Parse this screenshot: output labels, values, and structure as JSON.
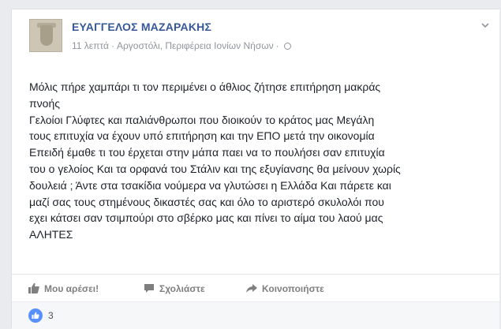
{
  "post": {
    "author": "ΕΥΑΓΓΕΛΟΣ ΜΑΖΑΡΑΚΗΣ",
    "time": "11 λεπτά",
    "separator": "·",
    "location": "Αργοστόλι, Περιφέρεια Ιονίων Νήσων",
    "privacy_icon": "globe-icon",
    "menu_icon": "chevron-down-icon",
    "text": "Μόλις πήρε χαμπάρι τι τον περιμένει ο άθλιος ζήτησε επιτήρηση μακράς\nπνοής\nΓελοίοι Γλύφτες και παλιάνθρωποι που διοικούν το κράτος μας Μεγάλη\nτους επιτυχία να έχουν υπό επιτήρηση και την ΕΠΟ μετά την οικονομία\nΕπειδή έμαθε τι του έρχεται στην μάπα παει να το πουλήσει σαν επιτυχία\nτου ο γελοίος Και τα ορφανά του Στάλιν και της εξυγίανσης θα μείνουν χωρίς\nδουλειά ; Άντε στα τσακίδια νούμερα να γλυτώσει η Ελλάδα Και πάρετε και\nμαζί σας τους στημένους δικαστές σας και όλο το αριστερό σκυλολόι που\nεχει κάτσει σαν τσιμπούρι στο σβέρκο μας και πίνει το αίμα του λαού μας\nΑΛΗΤΕΣ"
  },
  "actions": {
    "like_label": "Μου αρέσει!",
    "comment_label": "Σχολιάστε",
    "share_label": "Κοινοποιήστε"
  },
  "reactions": {
    "like_count": "3"
  },
  "colors": {
    "author": "#365899",
    "like_badge": "#5890ff",
    "text": "#1d2129",
    "meta": "#90949c"
  }
}
